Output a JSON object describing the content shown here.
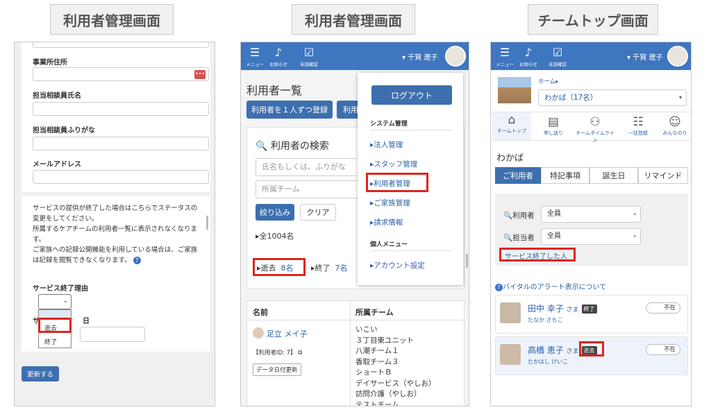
{
  "captions": [
    "利用者管理画面",
    "利用者管理画面",
    "チームトップ画面"
  ],
  "panel1": {
    "labels": [
      "事業所住所",
      "担当相談員氏名",
      "担当相談員ふりがな",
      "メールアドレス"
    ],
    "note_lines": [
      "サービスの提供が終了した場合はこちらでステータスの",
      "変更をしてください。",
      "所属するケアチームの利用者一覧に表示されなくなりま",
      "す。",
      "ご家族への記録公開機能を利用している場合は、ご家族",
      "は記録を閲覧できなくなります。"
    ],
    "end_reason_label": "サービス終了理由",
    "end_date_label_partial": "サ",
    "end_date_label_tail": "日",
    "options": [
      "逝去",
      "終了"
    ],
    "update_button": "更新する"
  },
  "header": {
    "menu": "メニュー",
    "notice": "お知らせ",
    "unconfirmed": "未読確認",
    "user": "▾ 千賀 遼子"
  },
  "panel2": {
    "title": "利用者一覧",
    "register_one": "利用者を１人ずつ登録",
    "register_bulk": "利用",
    "search_title": "利用者の検索",
    "name_placeholder": "氏名もしくは、ふりがな",
    "team_placeholder": "所属チーム",
    "filter_button": "絞り込み",
    "clear_button": "クリア",
    "total": "▸全1004名",
    "deceased_label": "▸逝去",
    "deceased_count": "8名",
    "ended_label": "▸終了",
    "ended_count": "7名",
    "col_name": "名前",
    "col_team": "所属チーム",
    "user_name": "足立 メイ子",
    "user_id": "【利用者ID: 7】",
    "data_update": "データ日付更新",
    "teams": [
      "いこい",
      "３丁目東ユニット",
      "八潮チーム１",
      "香取チーム３",
      "ショートＢ",
      "デイサービス（やしお）",
      "訪問介護（やしお）",
      "テストチーム"
    ],
    "menu": {
      "logout": "ログアウト",
      "system_admin": "システム管理",
      "items": [
        "▸法人管理",
        "▸スタッフ管理",
        "▸利用者管理",
        "▸ご家族管理",
        "▸請求情報"
      ],
      "personal": "個人メニュー",
      "account": "▸アカウント設定"
    }
  },
  "panel3": {
    "home": "ホーム▸",
    "team_select": "わかば（17名）",
    "nav": [
      "チームトップ",
      "申し送り",
      "チームタイムライン",
      "一括登録",
      "みんなのり"
    ],
    "team_name": "わかば",
    "tabs": [
      "ご利用者",
      "特記事項",
      "誕生日",
      "リマインド"
    ],
    "filter_user_label": "利用者",
    "filter_staff_label": "担当者",
    "all": "全員",
    "service_ended": "サービス終了した人",
    "vital_link": "バイタルのアラート表示について",
    "users": [
      {
        "name": "田中 幸子",
        "sama": "さま",
        "badge": "終了",
        "kana": "たなか さちこ",
        "status": "不在"
      },
      {
        "name": "高橋 恵子",
        "sama": "さま",
        "badge": "逝去",
        "kana": "たかはし けいこ",
        "status": "不在"
      }
    ]
  },
  "colors": {
    "primary": "#3f76c0",
    "button": "#3d6fae",
    "highlight": "#e0231c",
    "link": "#2b5fa6"
  },
  "icons": [
    "hamburger-icon",
    "bell-icon",
    "clipboard-check-icon",
    "search-icon",
    "copy-icon",
    "home-icon",
    "clipboard-icon",
    "people-icon",
    "list-icon",
    "person-clock-icon",
    "help-icon",
    "chevron-down-icon",
    "calendar-icon"
  ]
}
